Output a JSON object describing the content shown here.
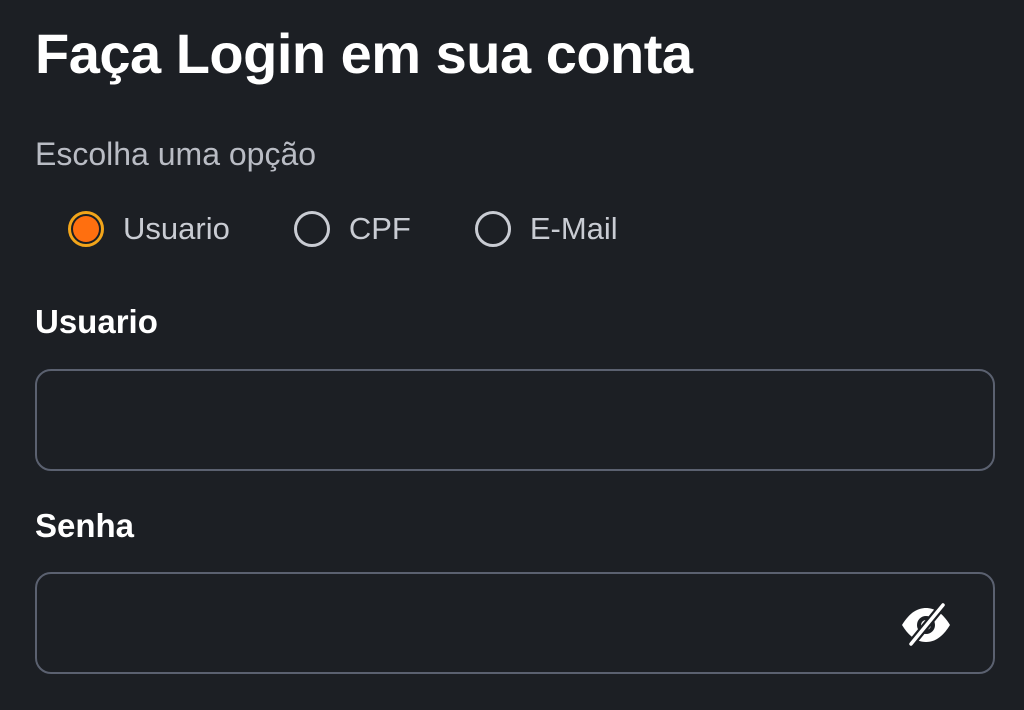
{
  "header": {
    "title": "Faça Login em sua conta"
  },
  "login_type": {
    "prompt": "Escolha uma opção",
    "options": [
      {
        "label": "Usuario",
        "selected": true
      },
      {
        "label": "CPF",
        "selected": false
      },
      {
        "label": "E-Mail",
        "selected": false
      }
    ]
  },
  "username": {
    "label": "Usuario",
    "value": "",
    "placeholder": ""
  },
  "password": {
    "label": "Senha",
    "value": "",
    "placeholder": "",
    "toggle_icon": "eye-off-icon"
  },
  "colors": {
    "background": "#1c1f24",
    "accent": "#ff6f0f",
    "accent_ring": "#f2a51a",
    "input_border": "#5b6170"
  }
}
